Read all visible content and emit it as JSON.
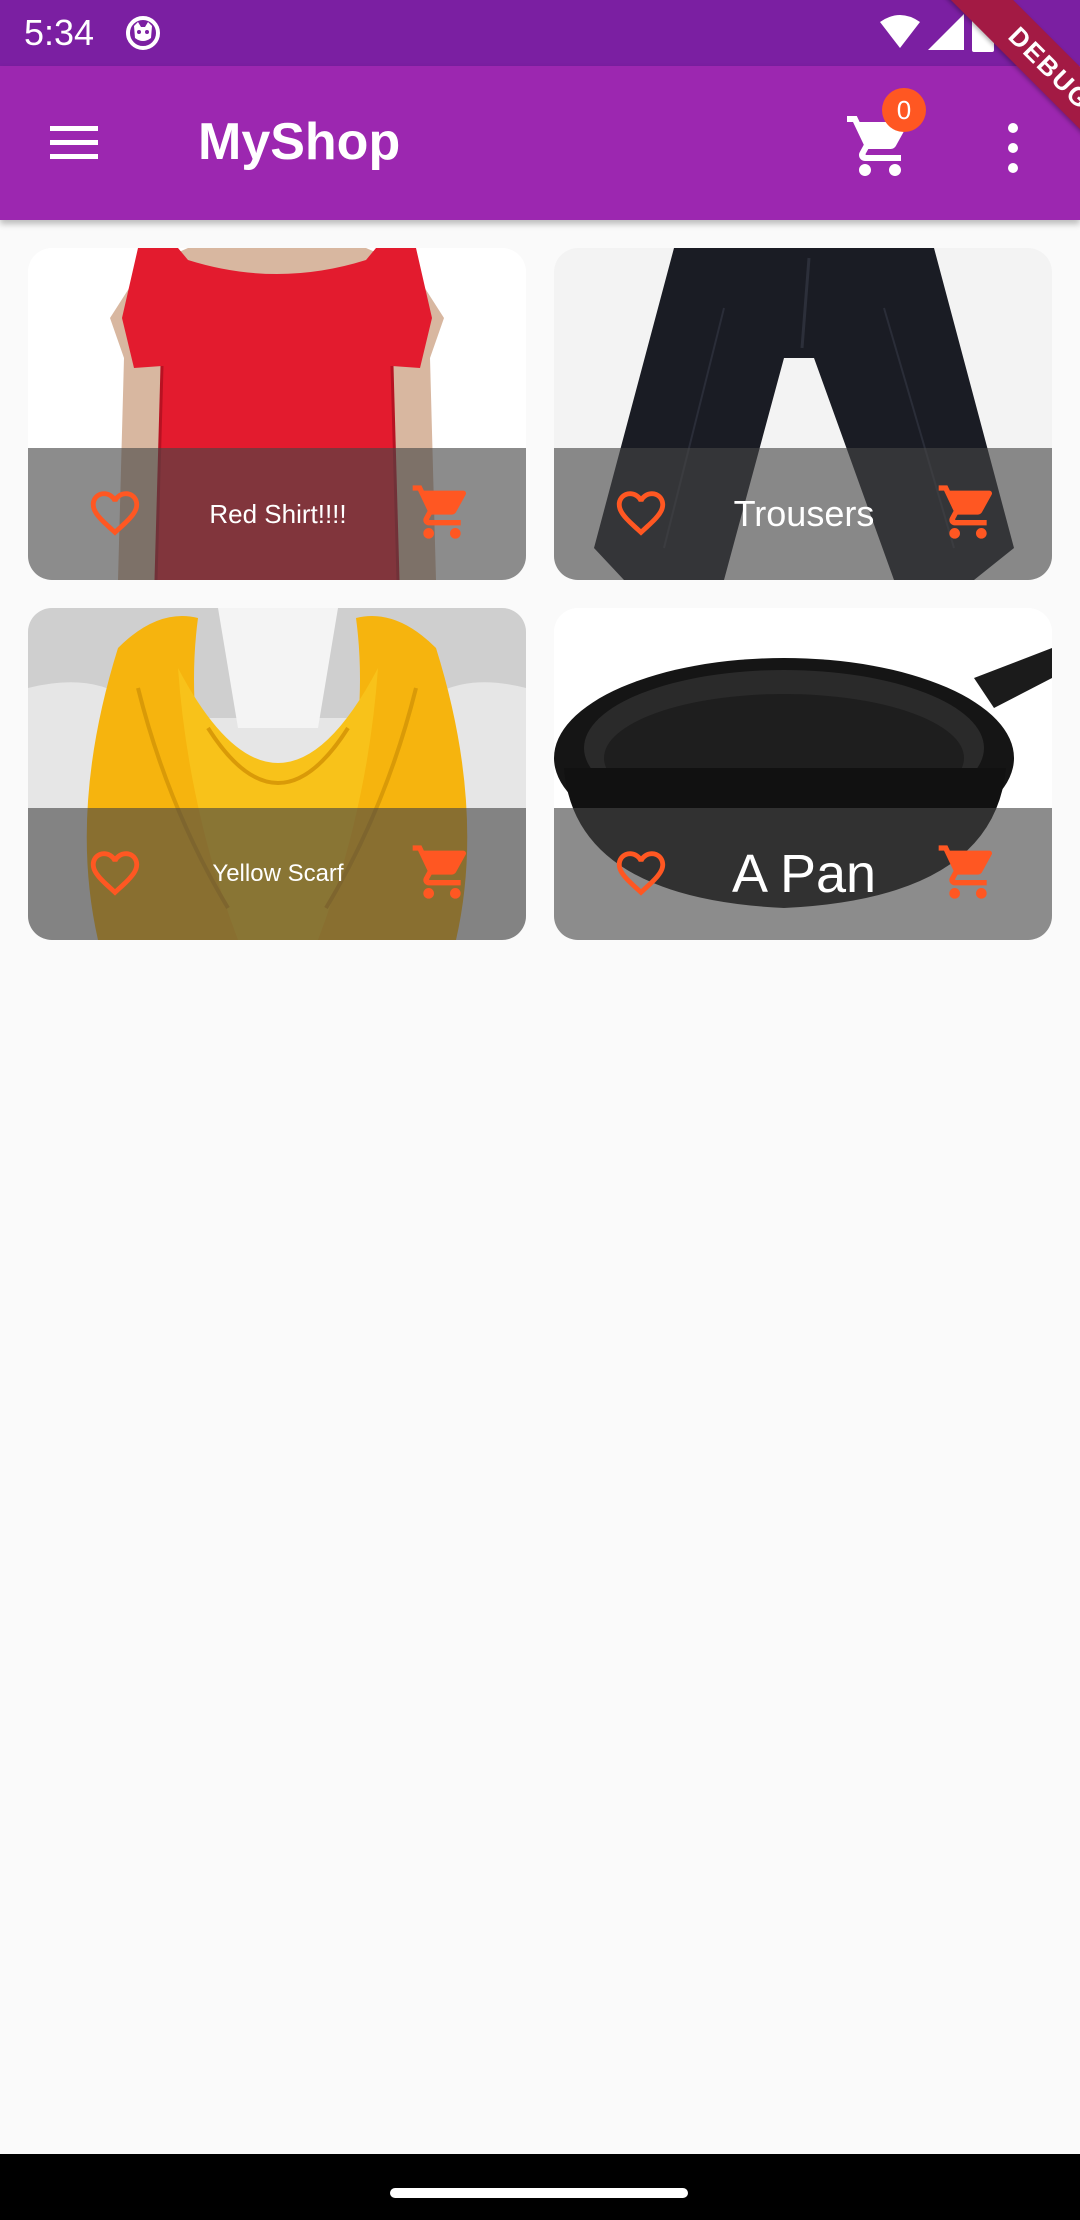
{
  "status_bar": {
    "time": "5:34"
  },
  "app_bar": {
    "title": "MyShop",
    "cart_count": "0",
    "debug_label": "DEBUG"
  },
  "colors": {
    "status_bar": "#7b1fa2",
    "app_bar": "#9c27b0",
    "accent": "#ff5722"
  },
  "products": [
    {
      "title": "Red Shirt!!!!",
      "image": "red-shirt"
    },
    {
      "title": "Trousers",
      "image": "trousers"
    },
    {
      "title": "Yellow Scarf",
      "image": "yellow-scarf"
    },
    {
      "title": "A Pan",
      "image": "pan"
    }
  ]
}
